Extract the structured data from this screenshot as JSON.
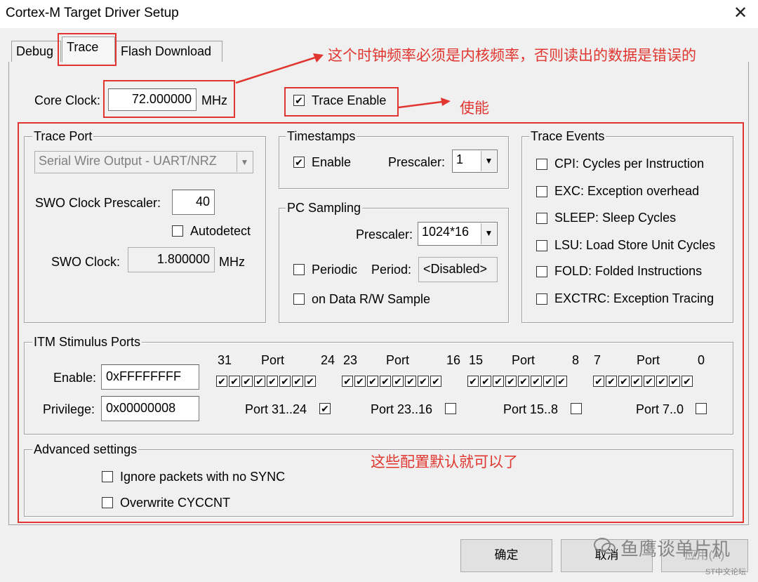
{
  "window": {
    "title": "Cortex-M Target Driver Setup",
    "close_glyph": "✕"
  },
  "tabs": [
    {
      "label": "Debug"
    },
    {
      "label": "Trace"
    },
    {
      "label": "Flash Download"
    }
  ],
  "core_clock": {
    "label": "Core Clock:",
    "value": "72.000000",
    "unit": "MHz"
  },
  "trace_enable": {
    "label": "Trace Enable",
    "checked": true
  },
  "trace_port": {
    "title": "Trace Port",
    "selected": "Serial Wire Output - UART/NRZ",
    "swo_prescaler_label": "SWO Clock Prescaler:",
    "swo_prescaler_value": "40",
    "autodetect_label": "Autodetect",
    "swo_clock_label": "SWO Clock:",
    "swo_clock_value": "1.800000",
    "swo_clock_unit": "MHz"
  },
  "timestamps": {
    "title": "Timestamps",
    "enable_label": "Enable",
    "prescaler_label": "Prescaler:",
    "prescaler_value": "1"
  },
  "pc_sampling": {
    "title": "PC Sampling",
    "prescaler_label": "Prescaler:",
    "prescaler_value": "1024*16",
    "periodic_label": "Periodic",
    "period_label": "Period:",
    "period_value": "<Disabled>",
    "on_data_label": "on Data R/W Sample"
  },
  "trace_events": {
    "title": "Trace Events",
    "items": [
      "CPI: Cycles per Instruction",
      "EXC: Exception overhead",
      "SLEEP: Sleep Cycles",
      "LSU: Load Store Unit Cycles",
      "FOLD: Folded Instructions",
      "EXCTRC: Exception Tracing"
    ]
  },
  "itm": {
    "title": "ITM Stimulus Ports",
    "enable_label": "Enable:",
    "enable_value": "0xFFFFFFFF",
    "privilege_label": "Privilege:",
    "privilege_value": "0x00000008",
    "port_word": "Port",
    "numbers": [
      "31",
      "24",
      "23",
      "16",
      "15",
      "8",
      "7",
      "0"
    ],
    "privilege_groups": [
      {
        "label": "Port 31..24",
        "checked": true
      },
      {
        "label": "Port 23..16",
        "checked": false
      },
      {
        "label": "Port 15..8",
        "checked": false
      },
      {
        "label": "Port 7..0",
        "checked": false
      }
    ]
  },
  "advanced": {
    "title": "Advanced settings",
    "ignore_label": "Ignore packets with no SYNC",
    "overwrite_label": "Overwrite CYCCNT"
  },
  "buttons": {
    "ok": "确定",
    "cancel": "取消",
    "apply": "应用(A)"
  },
  "annotations": {
    "clock_note": "这个时钟频率必须是内核频率，否则读出的数据是错误的",
    "enable_note": "使能",
    "default_note": "这些配置默认就可以了"
  },
  "watermark": {
    "brand": "鱼鹰谈单片机",
    "sub": "ST中文论坛"
  },
  "colors": {
    "annotation": "#e0362f",
    "dialog_bg": "#f0f0f0"
  }
}
